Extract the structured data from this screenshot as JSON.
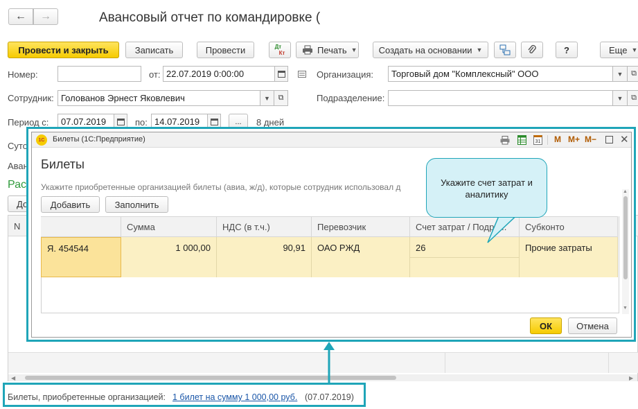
{
  "header": {
    "title": "Авансовый отчет по командировке (",
    "back_glyph": "←",
    "forward_glyph": "→"
  },
  "toolbar": {
    "post_close": "Провести и закрыть",
    "save": "Записать",
    "post": "Провести",
    "dtkt_top": "Дт",
    "dtkt_bottom": "Кт",
    "print": "Печать",
    "create_based": "Создать на основании",
    "help": "?",
    "more": "Еще"
  },
  "form": {
    "number_label": "Номер:",
    "number_value": "",
    "date_label": "от:",
    "date_value": "22.07.2019  0:00:00",
    "org_label": "Организация:",
    "org_value": "Торговый дом \"Комплексный\" ООО",
    "employee_label": "Сотрудник:",
    "employee_value": "Голованов Эрнест Яковлевич",
    "division_label": "Подразделение:",
    "division_value": "",
    "period_from_label": "Период с:",
    "period_from_value": "07.07.2019",
    "period_to_label": "по:",
    "period_to_value": "14.07.2019",
    "ellipsis": "...",
    "days": "8 дней",
    "hidden_label_1": "Суто",
    "hidden_label_2": "Аван",
    "hidden_label_3": "Рас",
    "hidden_btn": "До",
    "hidden_col": "N"
  },
  "dialog": {
    "window_title": "Билеты  (1С:Предприятие)",
    "logo": "1С",
    "heading": "Билеты",
    "hint": "Укажите приобретенные организацией билеты (авиа, ж/д), которые сотрудник использовал д",
    "add_button": "Добавить",
    "fill_button": "Заполнить",
    "m": "M",
    "mplus": "M+",
    "mminus": "M−",
    "calendar_day": "31",
    "columns": [
      "",
      "Сумма",
      "НДС (в т.ч.)",
      "Перевозчик",
      "Счет затрат / Подра...",
      "Субконто"
    ],
    "row": {
      "doc": "Я. 454544",
      "amount": "1 000,00",
      "vat": "90,91",
      "carrier": "ОАО РЖД",
      "account": "26",
      "subconto": "Прочие затраты"
    },
    "ok": "ОК",
    "cancel": "Отмена"
  },
  "callout": {
    "text": "Укажите счет затрат и аналитику"
  },
  "footer": {
    "label": "Билеты, приобретенные организацией:",
    "link": "1 билет на сумму 1 000,00 руб.",
    "date": "(07.07.2019)"
  },
  "colors": {
    "accent": "#1fa5b8",
    "primary_button": "#f6cb00",
    "selected_row": "#fbf0c4",
    "group_title": "#2e9a3a",
    "link": "#1a56a8"
  }
}
